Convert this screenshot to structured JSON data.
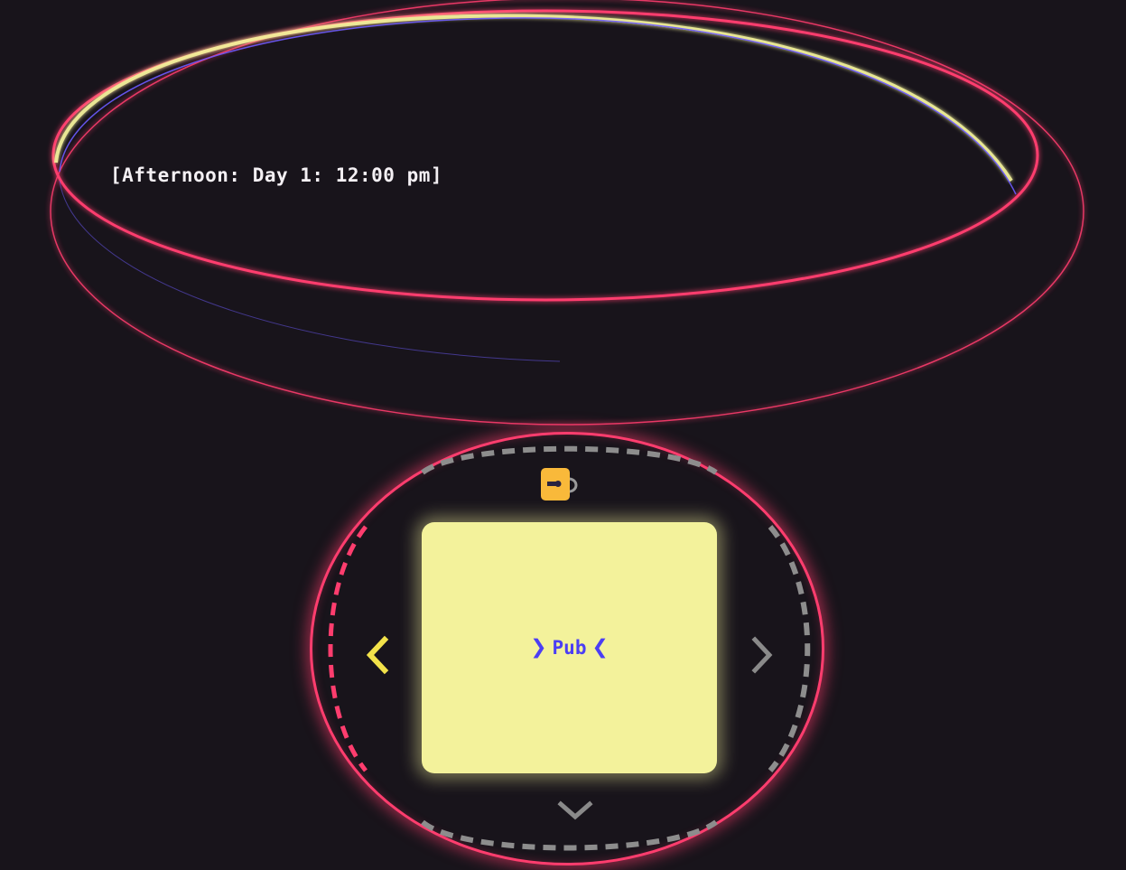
{
  "time_display": {
    "text": "[Afternoon: Day 1: 12:00 pm]"
  },
  "location": {
    "name": "Pub"
  },
  "navigation": {
    "left_arrow_icon": "chevron-left-icon",
    "right_arrow_icon": "chevron-right-icon",
    "down_arrow_icon": "chevron-down-icon",
    "lock_icon": "lock-icon"
  },
  "colors": {
    "background": "#18141b",
    "neon_red": "#ff3d6e",
    "neon_yellow": "#f3f29b",
    "neon_purple": "#4b3ef4",
    "lock_orange": "#f9b93a",
    "arrow_active": "#f2e24a",
    "arrow_inactive": "#8a8a8a"
  }
}
